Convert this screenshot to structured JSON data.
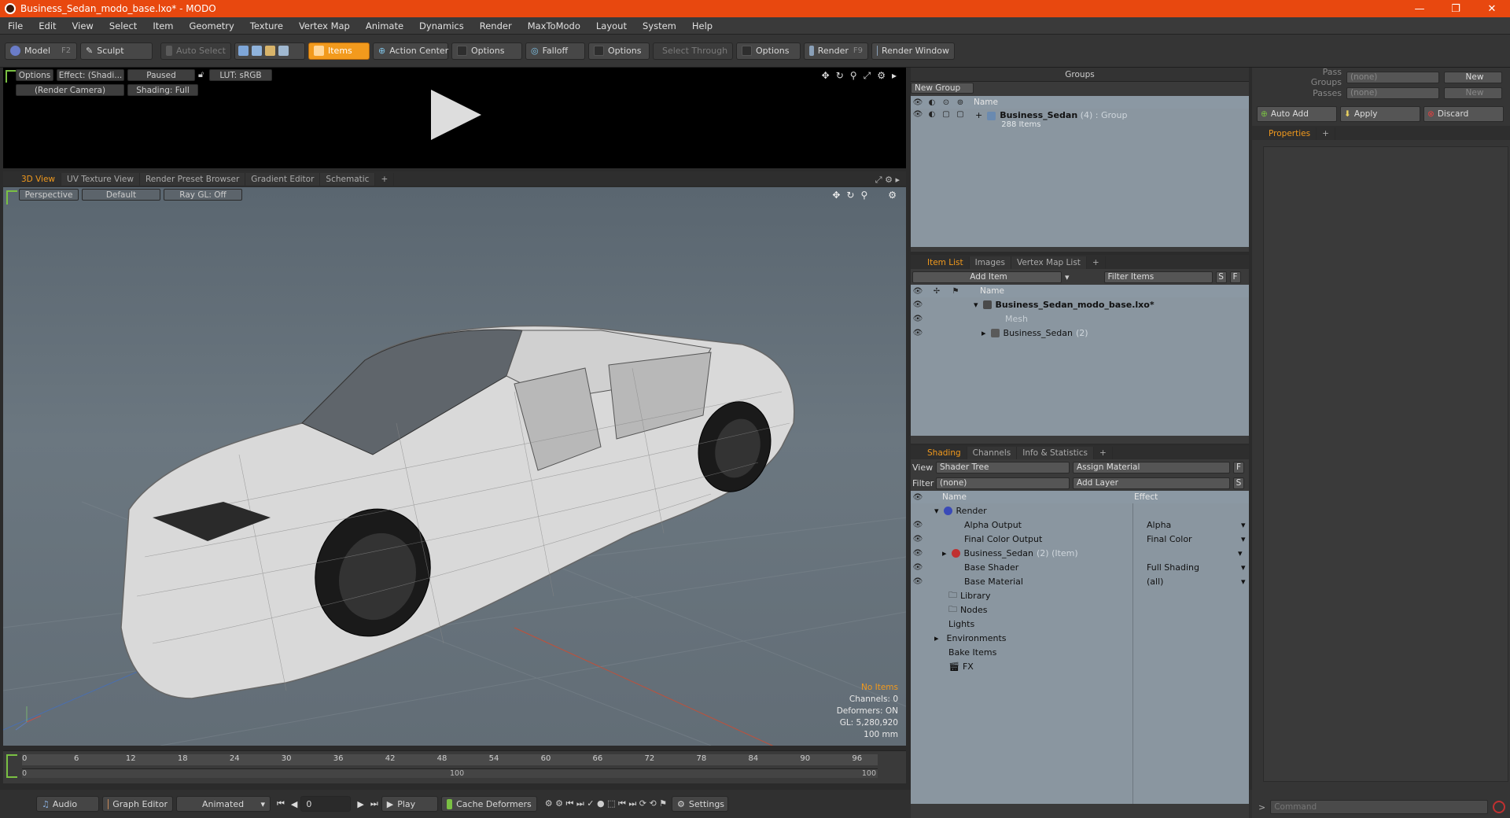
{
  "window": {
    "title": "Business_Sedan_modo_base.lxo* - MODO"
  },
  "menu": [
    "File",
    "Edit",
    "View",
    "Select",
    "Item",
    "Geometry",
    "Texture",
    "Vertex Map",
    "Animate",
    "Dynamics",
    "Render",
    "MaxToModo",
    "Layout",
    "System",
    "Help"
  ],
  "toolbar": {
    "model": "Model",
    "model_key": "F2",
    "sculpt": "Sculpt",
    "auto_select": "Auto Select",
    "items": "Items",
    "action_center": "Action Center",
    "options1": "Options",
    "falloff": "Falloff",
    "options2": "Options",
    "select_through": "Select Through",
    "options3": "Options",
    "render": "Render",
    "render_key": "F9",
    "render_window": "Render Window"
  },
  "render_view": {
    "options": "Options",
    "effect": "Effect: (Shadi...",
    "paused": "Paused",
    "lut": "LUT: sRGB",
    "camera": "(Render Camera)",
    "shading": "Shading: Full"
  },
  "viewport_tabs": [
    "3D View",
    "UV Texture View",
    "Render Preset Browser",
    "Gradient Editor",
    "Schematic",
    "+"
  ],
  "viewport": {
    "perspective": "Perspective",
    "default": "Default",
    "raygl": "Ray GL: Off",
    "info": {
      "no_items": "No Items",
      "channels": "Channels: 0",
      "deformers": "Deformers: ON",
      "gl": "GL: 5,280,920",
      "scale": "100 mm"
    }
  },
  "timeline": {
    "ticks": [
      "0",
      "6",
      "12",
      "18",
      "24",
      "30",
      "36",
      "42",
      "48",
      "54",
      "60",
      "66",
      "72",
      "78",
      "84",
      "90",
      "96"
    ],
    "subticks": [
      "0",
      "100",
      "100"
    ]
  },
  "bottom": {
    "audio": "Audio",
    "graph_editor": "Graph Editor",
    "animated": "Animated",
    "frame": "0",
    "play": "Play",
    "cache": "Cache Deformers",
    "settings": "Settings"
  },
  "groups": {
    "title": "Groups",
    "new_group": "New Group",
    "col_name": "Name",
    "item_name": "Business_Sedan",
    "item_count": "(4)",
    "item_type": ": Group",
    "item_sub": "288 Items"
  },
  "itemlist": {
    "tabs": [
      "Item List",
      "Images",
      "Vertex Map List",
      "+"
    ],
    "add_item": "Add Item",
    "filter": "Filter Items",
    "s": "S",
    "f": "F",
    "col_name": "Name",
    "rows": [
      {
        "label": "Business_Sedan_modo_base.lxo*",
        "extra": ""
      },
      {
        "label": "Mesh",
        "extra": ""
      },
      {
        "label": "Business_Sedan",
        "extra": "(2)"
      }
    ]
  },
  "shading": {
    "tabs": [
      "Shading",
      "Channels",
      "Info & Statistics",
      "+"
    ],
    "view_label": "View",
    "view_value": "Shader Tree",
    "assign": "Assign Material",
    "f": "F",
    "filter_label": "Filter",
    "filter_value": "(none)",
    "add_layer": "Add Layer",
    "s": "S",
    "col_name": "Name",
    "col_effect": "Effect",
    "rows": [
      {
        "name": "Render",
        "effect": ""
      },
      {
        "name": "Alpha Output",
        "effect": "Alpha"
      },
      {
        "name": "Final Color Output",
        "effect": "Final Color"
      },
      {
        "name": "Business_Sedan",
        "extra": "(2) (Item)",
        "effect": ""
      },
      {
        "name": "Base Shader",
        "effect": "Full Shading"
      },
      {
        "name": "Base Material",
        "effect": "(all)"
      },
      {
        "name": "Library",
        "effect": ""
      },
      {
        "name": "Nodes",
        "effect": ""
      },
      {
        "name": "Lights",
        "effect": ""
      },
      {
        "name": "Environments",
        "effect": ""
      },
      {
        "name": "Bake Items",
        "effect": ""
      },
      {
        "name": "FX",
        "effect": ""
      }
    ]
  },
  "properties": {
    "pass_groups_label": "Pass Groups",
    "pass_groups_value": "(none)",
    "new": "New",
    "passes_label": "Passes",
    "passes_value": "(none)",
    "new2": "New",
    "auto_add": "Auto Add",
    "apply": "Apply",
    "discard": "Discard",
    "tab": "Properties",
    "plus": "+",
    "command_placeholder": "Command"
  },
  "colors": {
    "accent": "#e8480f",
    "orange": "#f29a1d",
    "list_bg": "#8a96a0"
  }
}
